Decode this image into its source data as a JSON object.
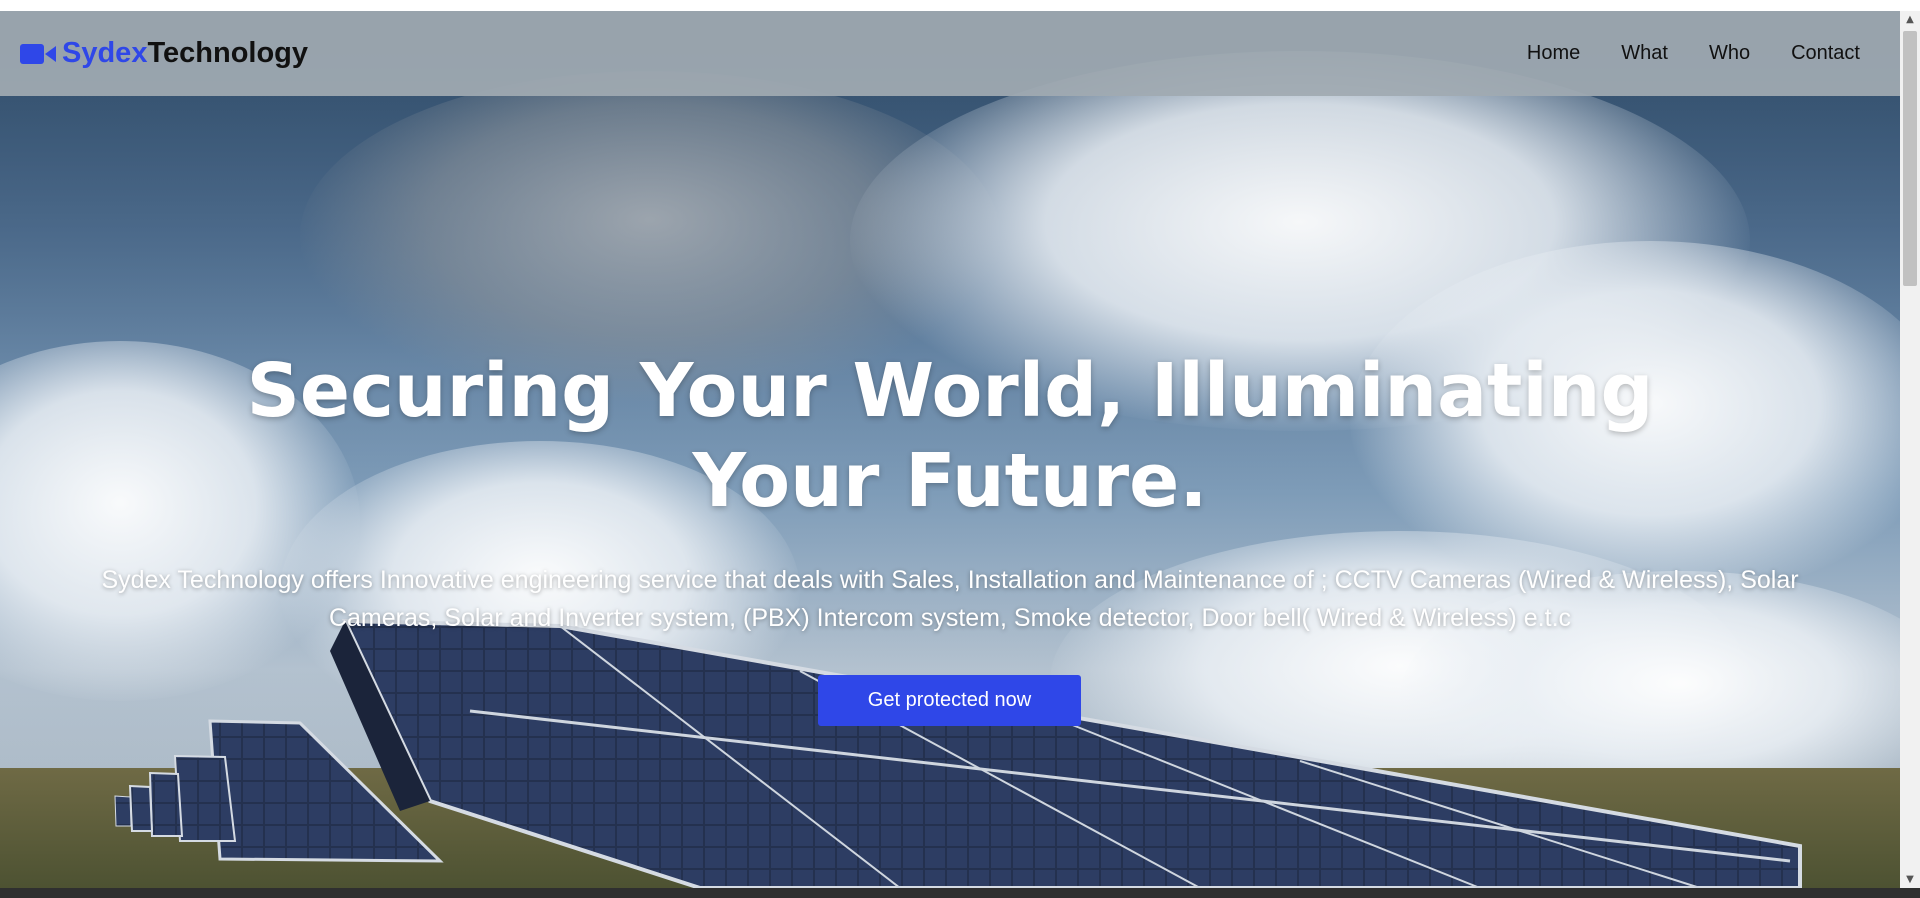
{
  "brand": {
    "icon": "video-camera-icon",
    "part1": "Sydex",
    "part2": "Technology",
    "accent_color": "#2f47e8"
  },
  "nav": {
    "items": [
      {
        "label": "Home"
      },
      {
        "label": "What"
      },
      {
        "label": "Who"
      },
      {
        "label": "Contact"
      }
    ]
  },
  "hero": {
    "headline": "Securing Your World, Illuminating Your Future.",
    "description": "Sydex Technology offers Innovative engineering service that deals with Sales, Installation and Maintenance of ; CCTV Cameras (Wired & Wireless), Solar Cameras, Solar and Inverter system, (PBX) Intercom system, Smoke detector, Door bell( Wired & Wireless) e.t.c",
    "cta_label": "Get protected now"
  }
}
